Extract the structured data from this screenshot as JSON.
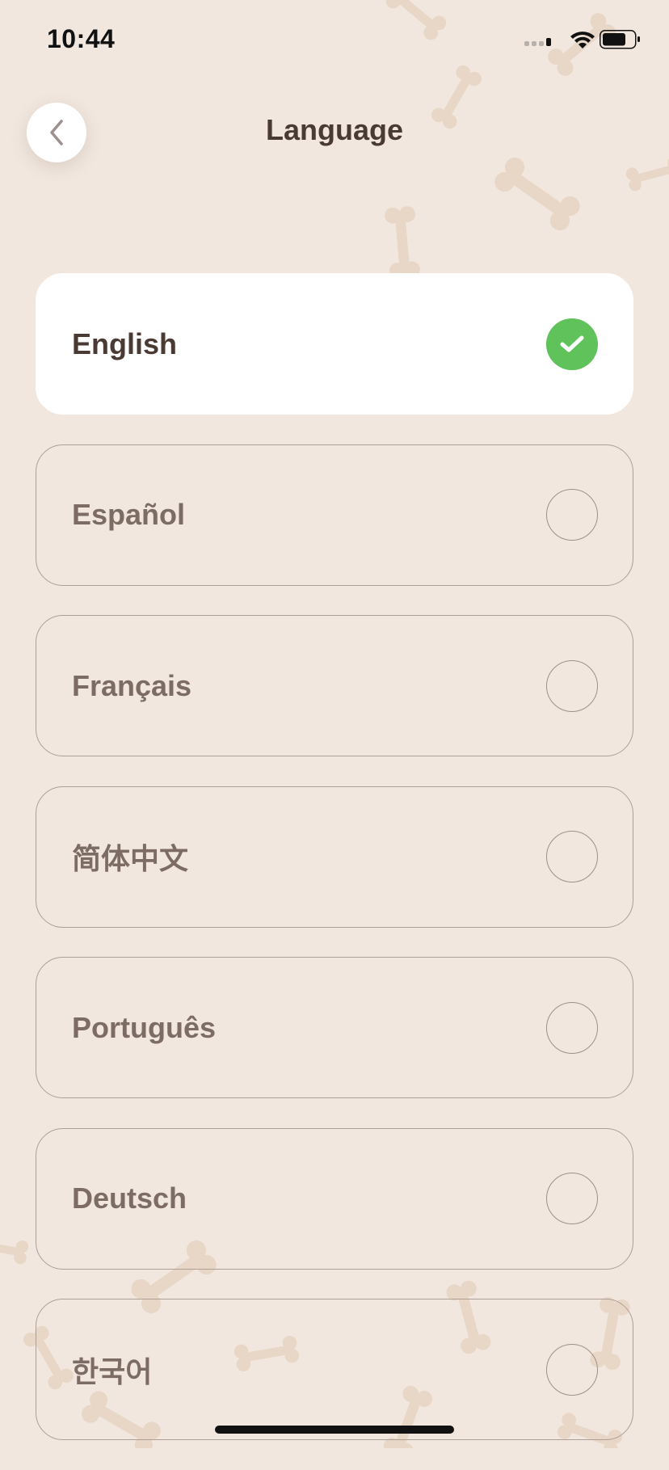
{
  "status_bar": {
    "time": "10:44",
    "icons": [
      "signal-icon",
      "wifi-icon",
      "battery-icon"
    ]
  },
  "header": {
    "back_icon": "chevron-left-icon",
    "title": "Language"
  },
  "languages": [
    {
      "label": "English",
      "selected": true
    },
    {
      "label": "Español",
      "selected": false
    },
    {
      "label": "Français",
      "selected": false
    },
    {
      "label": "简体中文",
      "selected": false
    },
    {
      "label": "Português",
      "selected": false
    },
    {
      "label": "Deutsch",
      "selected": false
    },
    {
      "label": "한국어",
      "selected": false
    }
  ],
  "colors": {
    "background": "#f1e7df",
    "bone_pattern": "#e8d6c7",
    "selected_check": "#5fc25a",
    "title_text": "#4a3a34",
    "option_text": "#7d6c64"
  }
}
